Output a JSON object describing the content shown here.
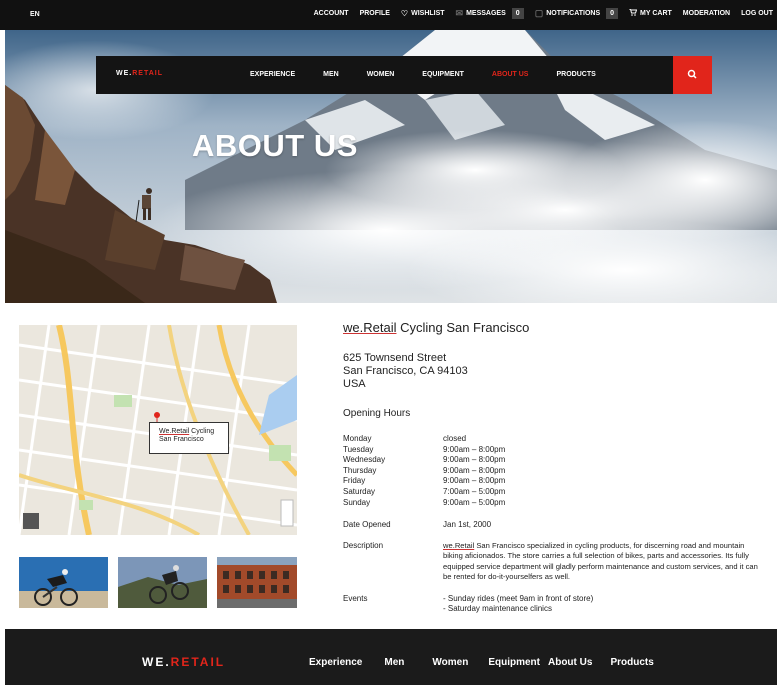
{
  "topbar": {
    "language": "EN",
    "account": "ACCOUNT",
    "profile": "PROFILE",
    "wishlist": "WISHLIST",
    "messages": "MESSAGES",
    "messages_count": "0",
    "notifications": "NOTIFICATIONS",
    "notifications_count": "0",
    "cart": "MY CART",
    "moderation": "MODERATION",
    "logout": "LOG OUT"
  },
  "nav": {
    "logo_main": "WE.",
    "logo_accent": "RETAIL",
    "items": [
      "EXPERIENCE",
      "MEN",
      "WOMEN",
      "EQUIPMENT",
      "ABOUT US",
      "PRODUCTS"
    ],
    "active_item": "ABOUT US",
    "search_icon": "search-icon"
  },
  "hero": {
    "title": "ABOUT US"
  },
  "map": {
    "label_brand": "We.Retail",
    "label_line1_rest": " Cycling",
    "label_line2": "San Francisco"
  },
  "store": {
    "title_brand": "we.Retail",
    "title_rest": " Cycling San Francisco",
    "address": [
      "625 Townsend Street",
      "San Francisco, CA 94103",
      "USA"
    ],
    "hours_heading": "Opening Hours",
    "days": [
      "Monday",
      "Tuesday",
      "Wednesday",
      "Thursday",
      "Friday",
      "Saturday",
      "Sunday"
    ],
    "times": [
      "closed",
      "9:00am – 8:00pm",
      "9:00am – 8:00pm",
      "9:00am – 8:00pm",
      "9:00am – 8:00pm",
      "7:00am – 5:00pm",
      "9:00am – 5:00pm"
    ],
    "date_opened_label": "Date Opened",
    "date_opened_value": "Jan 1st, 2000",
    "description_label": "Description",
    "description_brand": "we.Retail",
    "description_rest": " San Francisco specialized in cycling products, for discerning road and mountain biking aficionados. The store carries a full selection of bikes, parts and accessories. Its fully equipped service department will gladly perform maintenance and custom services, and it can be rented for do-it-yourselfers as well.",
    "events_label": "Events",
    "events": [
      "- Sunday rides (meet 9am in front of store)",
      "- Saturday maintenance clinics"
    ]
  },
  "footer": {
    "logo_main": "WE.",
    "logo_accent": "RETAIL",
    "items": [
      "Experience",
      "Men",
      "Women",
      "Equipment",
      "About Us",
      "Products"
    ]
  },
  "colors": {
    "accent": "#e1251b",
    "dark": "#141414"
  }
}
